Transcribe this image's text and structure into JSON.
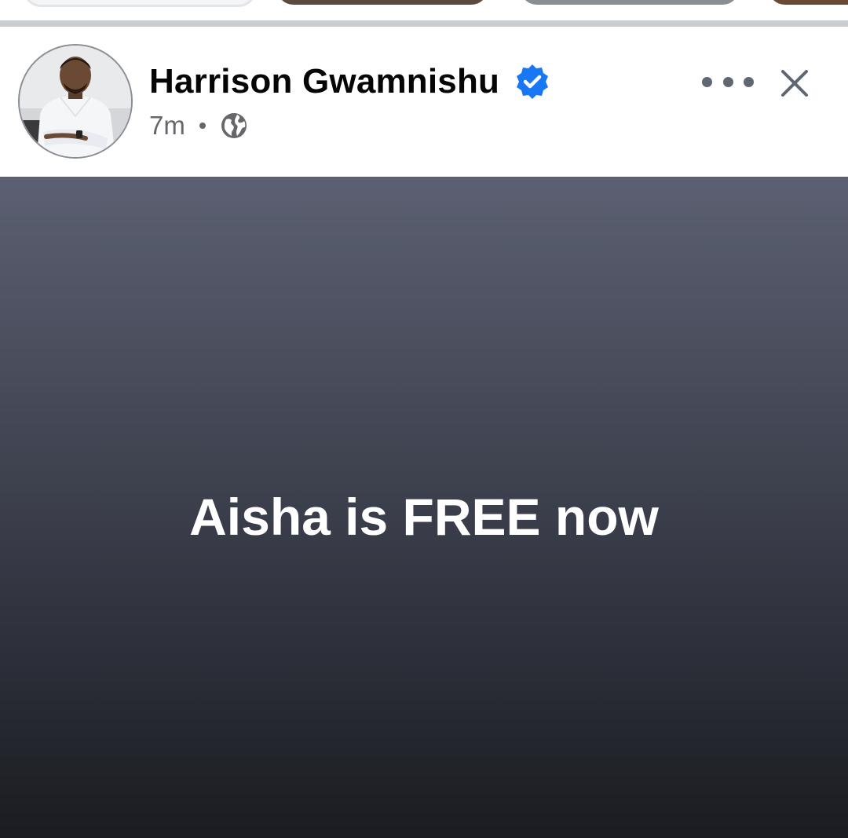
{
  "post": {
    "author_name": "Harrison Gwamnishu",
    "verified": true,
    "timestamp": "7m",
    "audience_icon": "globe-icon",
    "more_icon": "more-options-icon",
    "close_icon": "close-icon",
    "text": "Aisha is FREE now",
    "background_gradient": [
      "#5b6072",
      "#1b1c21"
    ]
  },
  "colors": {
    "verified_blue": "#1877f2",
    "secondary_text": "#65676b",
    "primary_text": "#050505"
  }
}
